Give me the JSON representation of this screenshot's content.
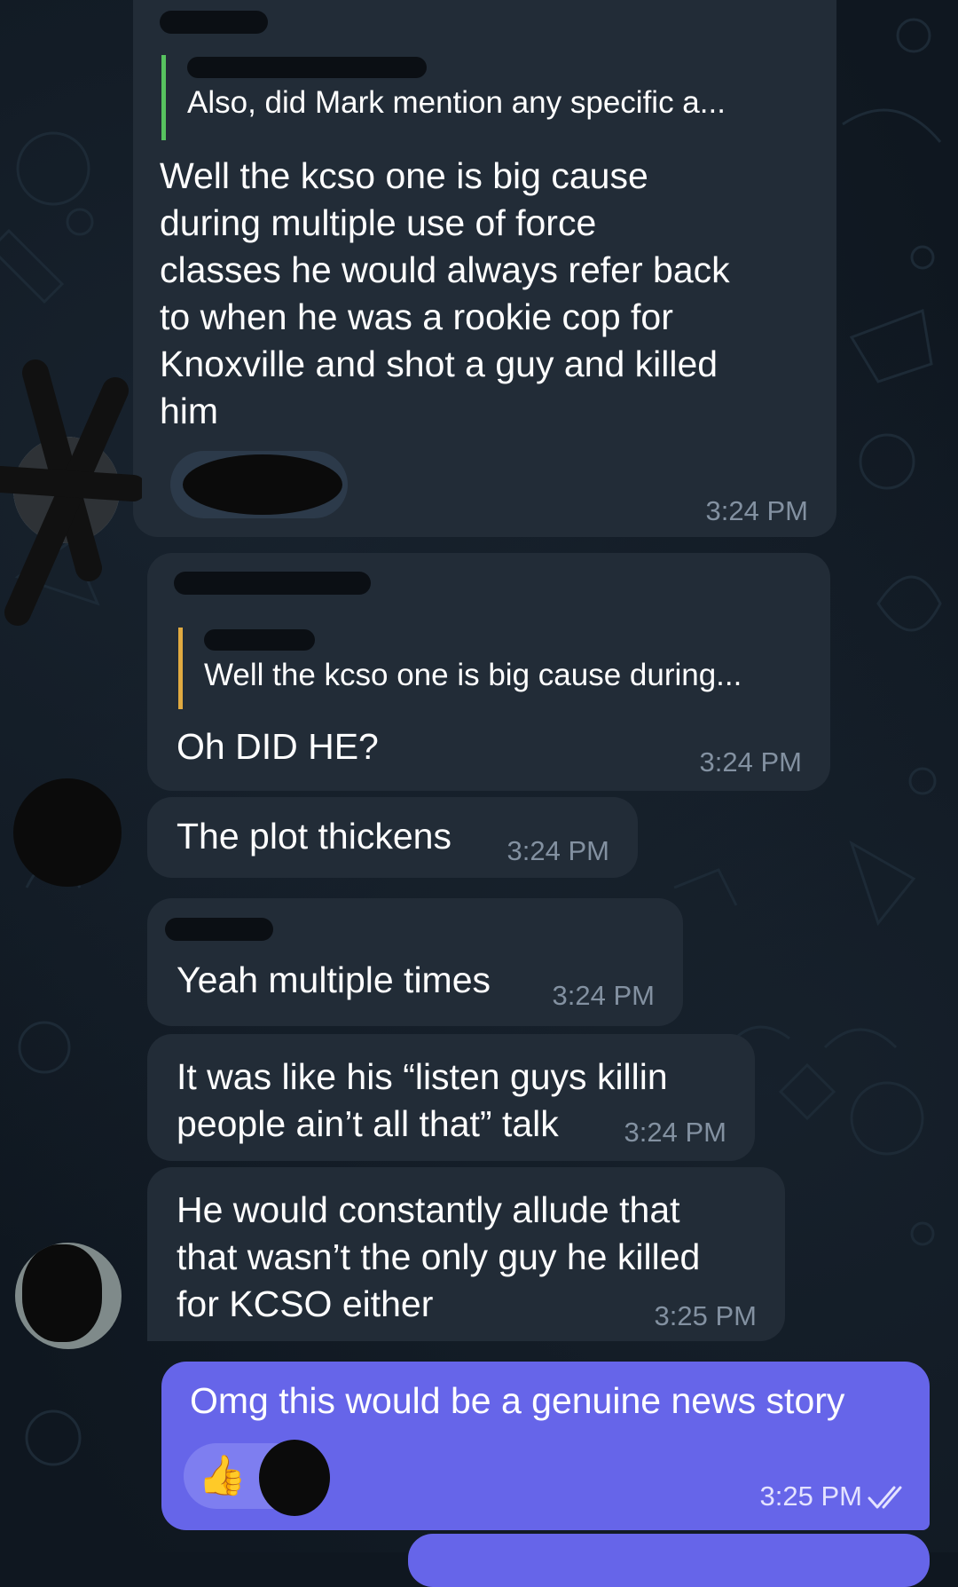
{
  "messages": [
    {
      "quote_text": "Also, did Mark mention any specific a...",
      "lines": [
        "Well the kcso one is big cause",
        "during multiple use of force",
        "classes he would always refer back",
        "to when he was a rookie cop for",
        "Knoxville and shot a guy and killed",
        "him"
      ],
      "time": "3:24 PM"
    },
    {
      "quote_text": "Well the kcso one is big cause during...",
      "lines": [
        "Oh DID HE?"
      ],
      "time": "3:24 PM"
    },
    {
      "lines": [
        "The plot thickens"
      ],
      "time": "3:24 PM"
    },
    {
      "lines": [
        "Yeah multiple times"
      ],
      "time": "3:24 PM"
    },
    {
      "lines": [
        "It was like his “listen guys killin",
        "people ain’t all that” talk"
      ],
      "time": "3:24 PM"
    },
    {
      "lines": [
        "He would constantly allude that",
        "that wasn’t the only guy he killed",
        "for KCSO either"
      ],
      "time": "3:25 PM"
    },
    {
      "lines": [
        "Omg this would be a genuine news story"
      ],
      "time": "3:25 PM",
      "reaction": "👍",
      "status_icon": "double-check-icon"
    }
  ],
  "colors": {
    "background": "#0f1720",
    "incoming_bubble": "#222c37",
    "outgoing_bubble": "#6665e9",
    "quote_bar_green": "#57c35f",
    "quote_bar_yellow": "#e0aa41",
    "timestamp": "#8391a1"
  }
}
